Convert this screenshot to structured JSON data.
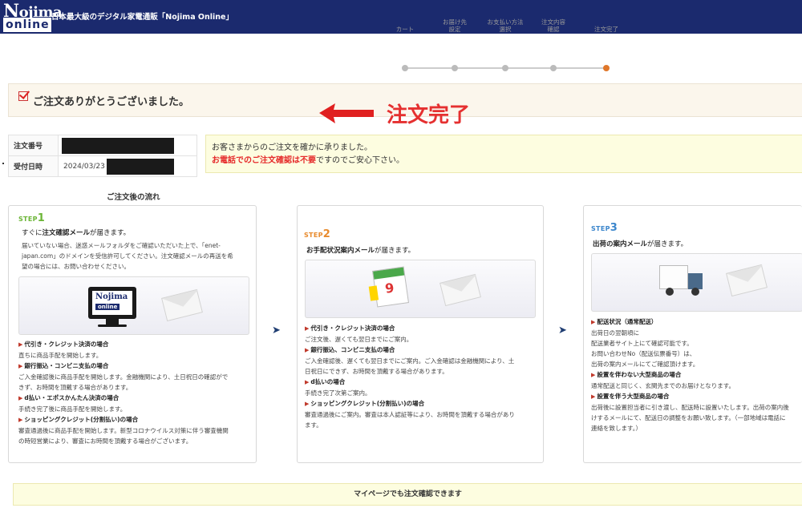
{
  "header": {
    "logo_top_first": "N",
    "logo_top_rest": "ojima",
    "logo_bottom": "online",
    "tagline": "日本最大級のデジタル家電通販「Nojima Online」"
  },
  "progress": {
    "steps": [
      "カート",
      "お届け先\n設定",
      "お支払い方法\n選択",
      "注文内容\n確認",
      "注文完了"
    ],
    "active_index": 4,
    "active_color": "#e0772a"
  },
  "thanks": {
    "title": "ご注文ありがとうございました。",
    "icon": "checkbox-check-icon"
  },
  "annotation": {
    "text": "注文完了",
    "color": "#e53030"
  },
  "order_info": {
    "number_label": "注文番号",
    "date_label": "受付日時",
    "date_value": "2024/03/23"
  },
  "notice": {
    "line1": "お客さまからのご注文を確かに承りました。",
    "line2_red": "お電話でのご注文確認は不要",
    "line2_rest": "ですのでご安心下さい。"
  },
  "flow": {
    "title": "ご注文後の流れ",
    "step_word": "STEP",
    "step1": {
      "num": "1",
      "head_pre": "すぐに",
      "head_bold": "注文確認メール",
      "head_post": "が届きます。",
      "text1": "届いていない場合、迷惑メールフォルダをご確認いただいた上で、「enet-",
      "text2": "japan.com」のドメインを受信許可してください。注文確認メールの再送を希",
      "text3": "望の場合には、お問い合わせください。",
      "monitor_top_first": "N",
      "monitor_top_rest": "ojima",
      "monitor_bottom": "online",
      "items": [
        {
          "h": "代引き・クレジット決済の場合",
          "lines": [
            "直ちに商品手配を開始します。"
          ]
        },
        {
          "h": "銀行振込・コンビニ支払の場合",
          "lines": [
            "ご入金確認後に商品手配を開始します。金融機関により、土日祝日の確認がで",
            "きず、お時間を頂戴する場合があります。"
          ]
        },
        {
          "h": "d払い・エポスかんたん決済の場合",
          "lines": [
            "手続き完了後に商品手配を開始します。"
          ]
        },
        {
          "h": "ショッピングクレジット(分割払い)の場合",
          "lines": [
            "審査通過後に商品手配を開始します。新型コロナウイルス対策に伴う審査機関",
            "の時短営業により、審査にお時間を頂戴する場合がございます。"
          ]
        }
      ]
    },
    "step2": {
      "num": "2",
      "head_bold": "お手配状況案内メール",
      "head_post": "が届きます。",
      "calendar_day": "9",
      "items": [
        {
          "h": "代引き・クレジット決済の場合",
          "lines": [
            "ご注文後、遅くても翌日までにご案内。"
          ]
        },
        {
          "h": "銀行振込、コンビニ支払の場合",
          "lines": [
            "ご入金確認後、遅くても翌日までにご案内。ご入金確認は金融機関により、土",
            "日祝日にできず、お時間を頂戴する場合があります。"
          ]
        },
        {
          "h": "d払いの場合",
          "lines": [
            "手続き完了次第ご案内。"
          ]
        },
        {
          "h": "ショッピングクレジット(分割払い)の場合",
          "lines": [
            "審査通過後にご案内。審査は本人認証等により、お時間を頂戴する場合があり",
            "ます。"
          ]
        }
      ]
    },
    "step3": {
      "num": "3",
      "head_bold": "出荷の案内メール",
      "head_post": "が届きます。",
      "items": [
        {
          "h": "配送状況（通常配送）",
          "lines": [
            "出荷日の翌朝頃に",
            "配送業者サイト上にて確認可能です。",
            "お問い合わせNo（配送伝票番号）は、",
            "出荷の案内メールにてご確認頂けます。"
          ]
        },
        {
          "h": "設置を伴わない大型商品の場合",
          "lines": [
            "通常配送と同じく、玄関先までのお届けとなります。"
          ]
        },
        {
          "h": "設置を伴う大型商品の場合",
          "lines": [
            "出荷後に設置担当者に引き渡し、配送時に設置いたします。出荷の案内後",
            "けするメールにて、配送日の調整をお願い致します。（一部地域は電話に",
            "連絡を致します。）"
          ]
        }
      ]
    }
  },
  "mypage_bar": {
    "text": "マイページでも注文確認できます"
  }
}
